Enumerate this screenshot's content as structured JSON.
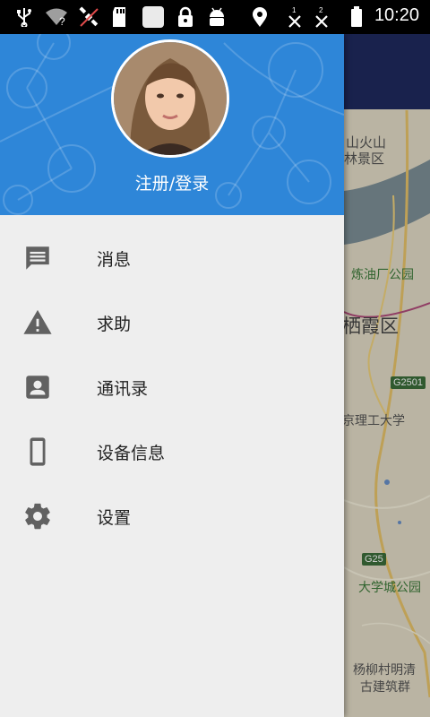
{
  "status_bar": {
    "time": "10:20",
    "icons": [
      "usb-icon",
      "wifi-unknown-icon",
      "satellite-icon",
      "sd-card-icon",
      "notification-icon",
      "lock-icon",
      "android-icon",
      "location-icon",
      "missed-call-1-icon",
      "missed-call-2-icon",
      "battery-icon"
    ],
    "missed_1": "1",
    "missed_2": "2",
    "wifi_badge": "?"
  },
  "drawer": {
    "header": {
      "login_label": "注册/登录",
      "color": "#2e86d8"
    },
    "menu": [
      {
        "label": "消息",
        "icon": "message-icon"
      },
      {
        "label": "求助",
        "icon": "warning-icon"
      },
      {
        "label": "通讯录",
        "icon": "contacts-icon"
      },
      {
        "label": "设备信息",
        "icon": "device-icon"
      },
      {
        "label": "设置",
        "icon": "settings-icon"
      }
    ]
  },
  "map": {
    "labels": [
      "山火山",
      "林景区",
      "炼油厂公园",
      "栖霞区",
      "京理工大学",
      "大学城公园",
      "杨柳村明清",
      "古建筑群"
    ],
    "shields": [
      "G2501",
      "G25"
    ]
  }
}
